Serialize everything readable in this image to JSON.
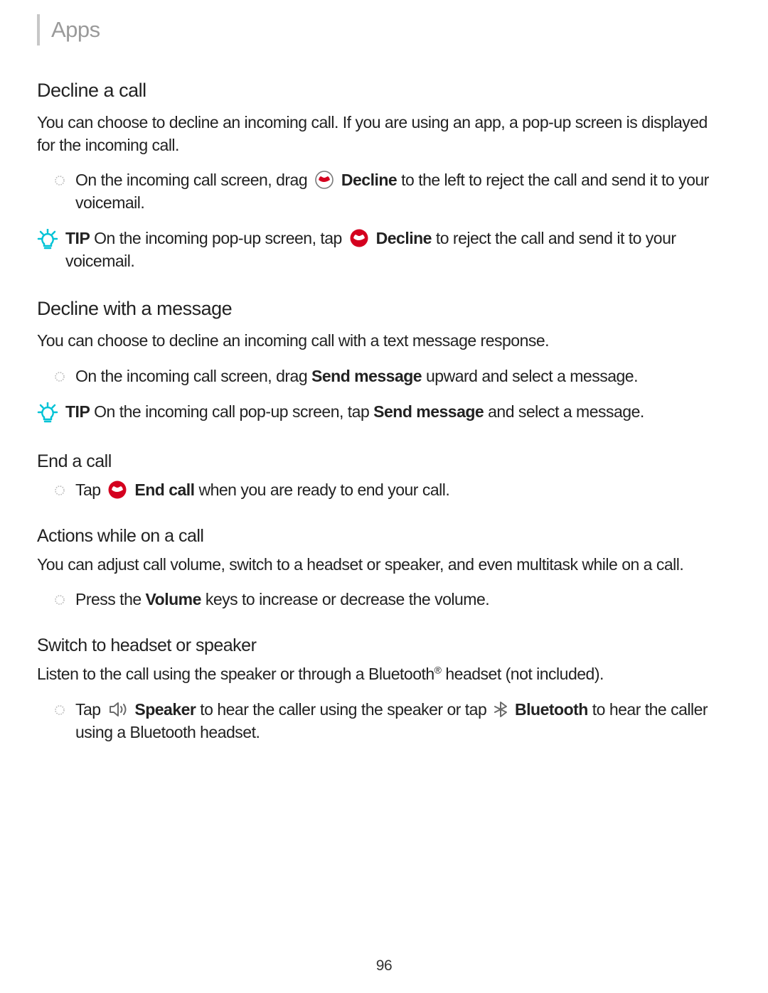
{
  "header": {
    "title": "Apps"
  },
  "sections": {
    "decline": {
      "title": "Decline a call",
      "intro": "You can choose to decline an incoming call. If you are using an app, a pop-up screen is displayed for the incoming call.",
      "bullet_pre": "On the incoming call screen, drag ",
      "bullet_bold": "Decline",
      "bullet_post": " to the left to reject the call and send it to your voicemail.",
      "tip_label": "TIP",
      "tip_pre": "  On the incoming pop-up screen, tap ",
      "tip_bold": "Decline",
      "tip_post": " to reject the call and send it to your voicemail."
    },
    "decline_msg": {
      "title": "Decline with a message",
      "intro": "You can choose to decline an incoming call with a text message response.",
      "bullet_pre": "On the incoming call screen, drag ",
      "bullet_bold": "Send message",
      "bullet_post": " upward and select a message.",
      "tip_label": "TIP",
      "tip_pre": "  On the incoming call pop-up screen, tap ",
      "tip_bold": "Send message",
      "tip_post": " and select a message."
    },
    "end": {
      "title": "End a call",
      "bullet_pre": "Tap ",
      "bullet_bold": "End call",
      "bullet_post": " when you are ready to end your call."
    },
    "actions": {
      "title": "Actions while on a call",
      "intro": "You can adjust call volume, switch to a headset or speaker, and even multitask while on a call.",
      "bullet_pre": "Press the ",
      "bullet_bold": "Volume",
      "bullet_post": " keys to increase or decrease the volume."
    },
    "switch": {
      "title": "Switch to headset or speaker",
      "intro_pre": "Listen to the call using the speaker or through a Bluetooth",
      "intro_sup": "®",
      "intro_post": " headset (not included).",
      "bullet_pre": "Tap ",
      "bullet_bold1": "Speaker",
      "bullet_mid": " to hear the caller using the speaker or tap ",
      "bullet_bold2": "Bluetooth",
      "bullet_post": " to hear the caller using a Bluetooth headset."
    }
  },
  "page_number": "96"
}
